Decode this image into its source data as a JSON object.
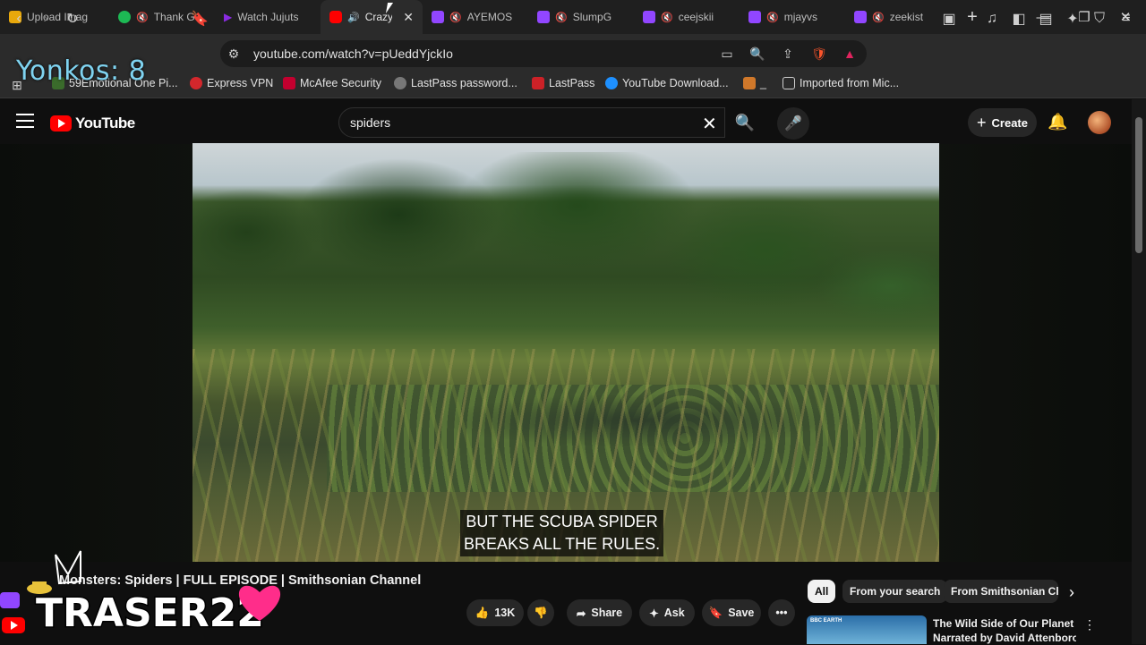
{
  "browser": {
    "tabs": [
      {
        "label": "Upload Imag",
        "icon": "upload-icon",
        "color": "#e8a80c",
        "muted": false,
        "active": false
      },
      {
        "label": "Thank G",
        "icon": "spotify-icon",
        "color": "#1db954",
        "muted": true,
        "active": false
      },
      {
        "label": "Watch Jujuts",
        "icon": "play-icon",
        "color": "#8a2be2",
        "muted": false,
        "active": false
      },
      {
        "label": "Crazy",
        "icon": "youtube-icon",
        "color": "#ff0000",
        "muted": false,
        "active": true
      },
      {
        "label": "AYEMOS",
        "icon": "twitch-icon",
        "color": "#9146ff",
        "muted": true,
        "active": false
      },
      {
        "label": "SlumpG",
        "icon": "twitch-icon",
        "color": "#9146ff",
        "muted": true,
        "active": false
      },
      {
        "label": "ceejskii",
        "icon": "twitch-icon",
        "color": "#9146ff",
        "muted": true,
        "active": false
      },
      {
        "label": "mjayvs",
        "icon": "twitch-icon",
        "color": "#9146ff",
        "muted": true,
        "active": false
      },
      {
        "label": "zeekist",
        "icon": "twitch-icon",
        "color": "#9146ff",
        "muted": true,
        "active": false
      }
    ],
    "url": "youtube.com/watch?v=pUeddYjckIo",
    "bookmarks": [
      {
        "label": "59Emotional One Pi...",
        "color": "#3a6b2b"
      },
      {
        "label": "Express VPN",
        "color": "#d3272c"
      },
      {
        "label": "McAfee Security",
        "color": "#c3002f"
      },
      {
        "label": "LastPass password...",
        "color": "#777777"
      },
      {
        "label": "LastPass",
        "color": "#cc2127"
      },
      {
        "label": "YouTube Download...",
        "color": "#1e90ff"
      },
      {
        "label": "_",
        "color": "#d0782a"
      },
      {
        "label": "Imported from Mic...",
        "color": "#cfcfcf"
      }
    ]
  },
  "overlay": {
    "counter_text": "Yonkos: 8"
  },
  "youtube": {
    "logo_text": "YouTube",
    "search_query": "spiders",
    "create_label": "Create",
    "caption_line1": "BUT THE SCUBA SPIDER",
    "caption_line2": "BREAKS ALL THE RULES.",
    "video_title": "Monsters: Spiders | FULL EPISODE | Smithsonian Channel",
    "actions": {
      "likes": "13K",
      "share": "Share",
      "ask": "Ask",
      "save": "Save"
    },
    "chips": [
      "All",
      "From your search",
      "From Smithsonian Char"
    ],
    "recommendation": {
      "title_line1": "The Wild Side of Our Planet |",
      "title_line2": "Narrated by David Attenborou...",
      "thumb_tag": "BBC EARTH"
    }
  },
  "watermark": {
    "text": "TRASER22"
  },
  "colors": {
    "accent_red": "#ff0000",
    "caption_bg": "#080808",
    "overlay_text": "#7fd3f0"
  }
}
